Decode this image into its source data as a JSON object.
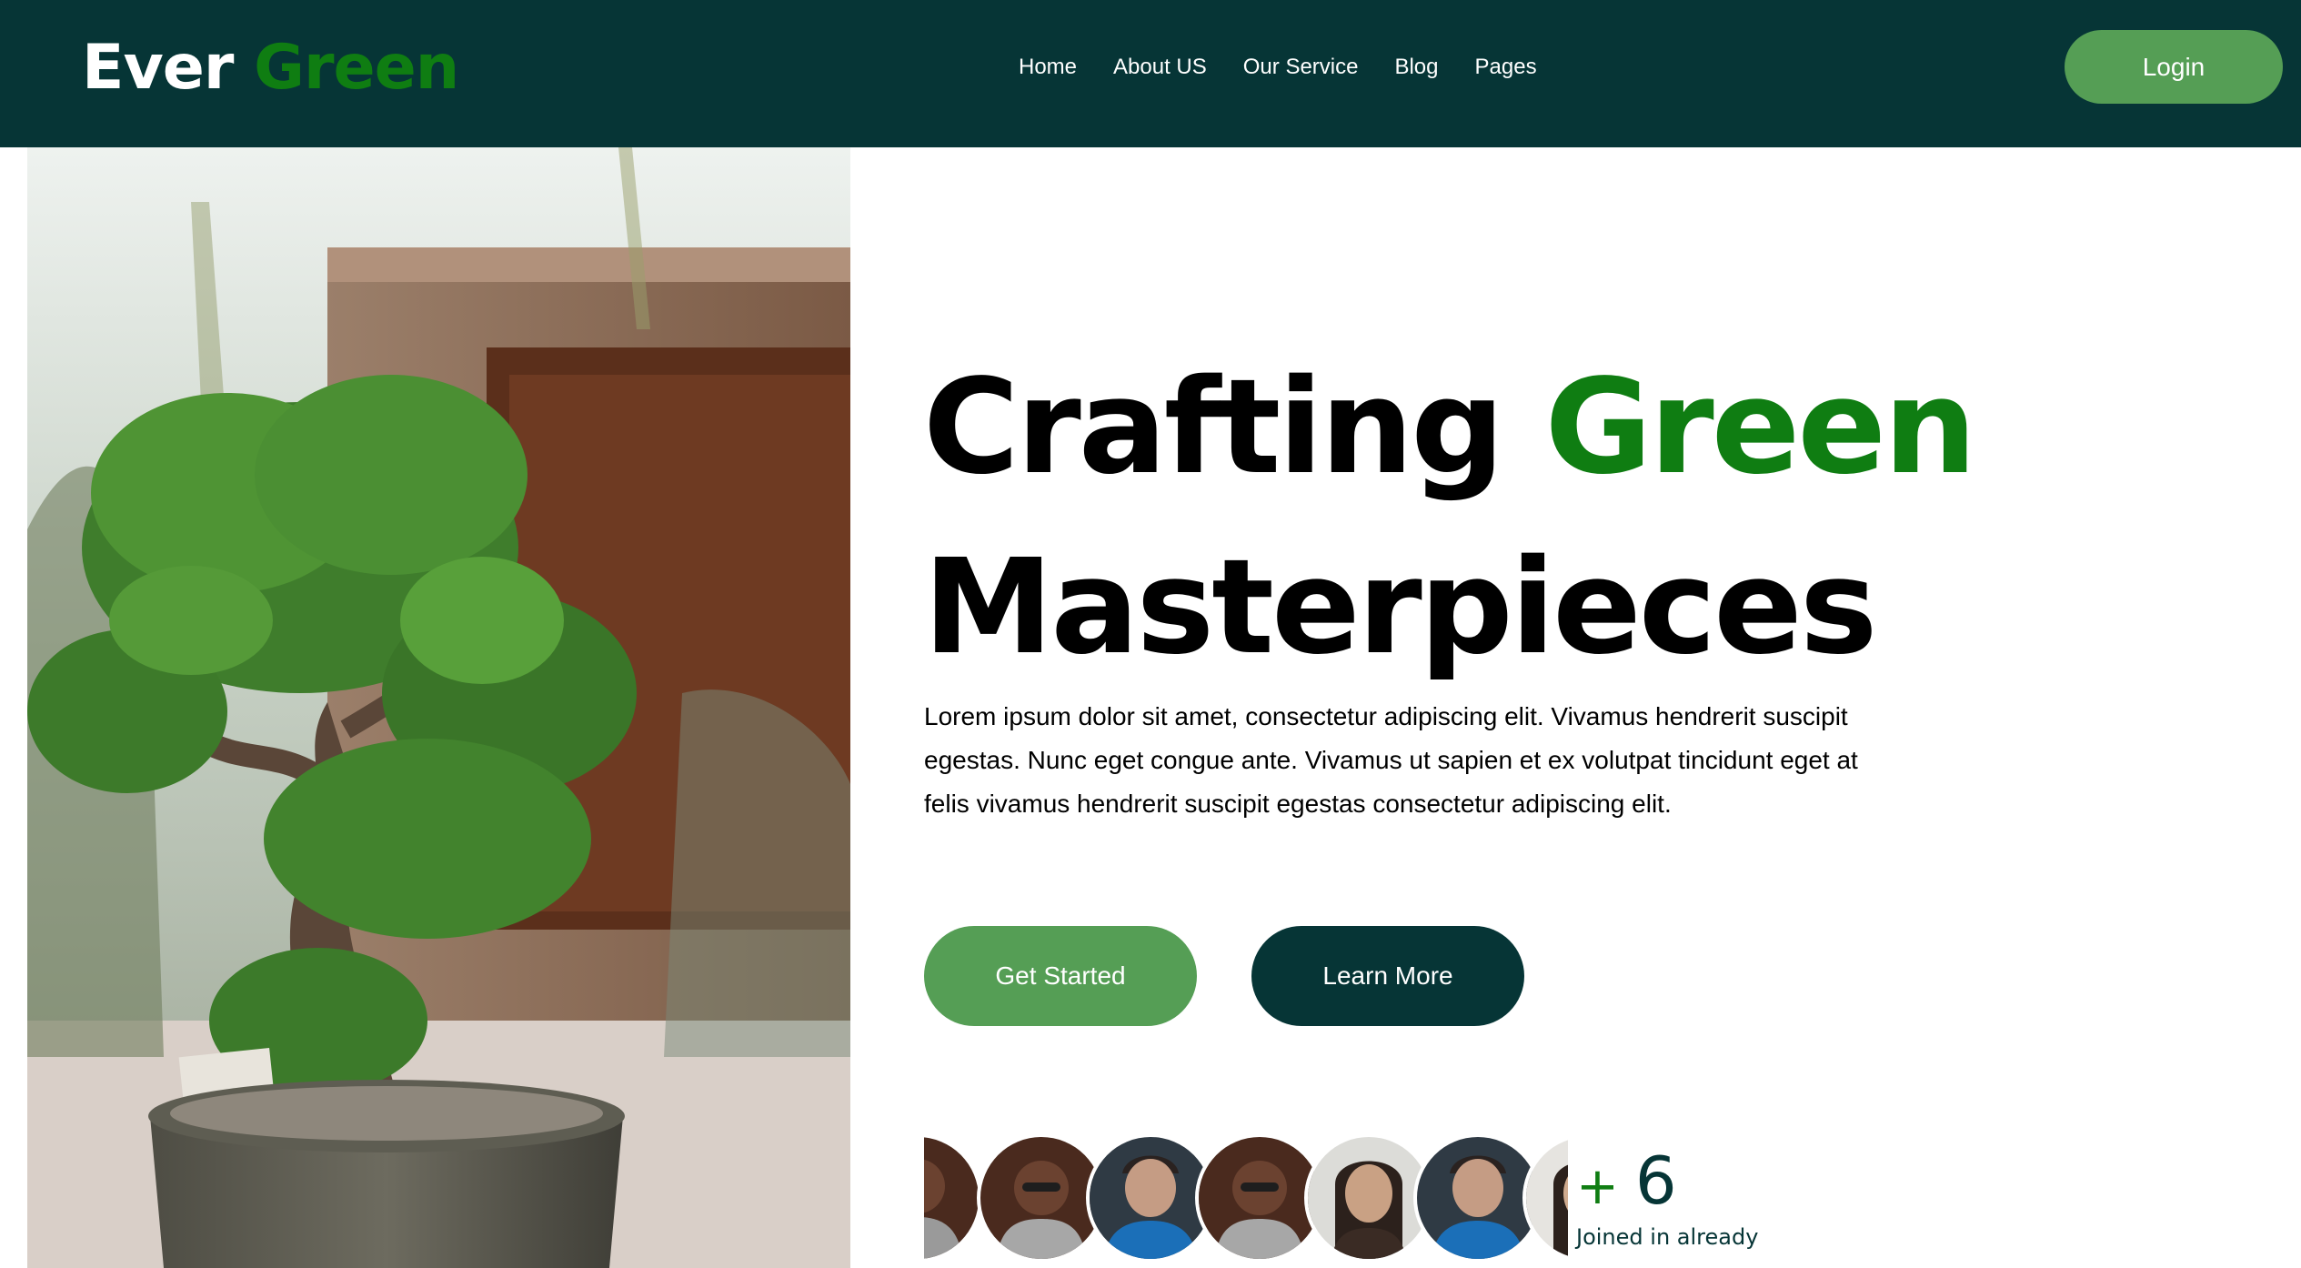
{
  "brand": {
    "name_primary": "Ever",
    "name_accent": "Green"
  },
  "nav": {
    "items": [
      "Home",
      "About US",
      "Our Service",
      "Blog",
      "Pages"
    ],
    "login_label": "Login"
  },
  "hero": {
    "headline_line1_primary": "Crafting",
    "headline_line1_accent": "Green",
    "headline_line2": "Masterpieces",
    "description": "Lorem ipsum dolor sit amet, consectetur adipiscing elit. Vivamus hendrerit suscipit egestas. Nunc eget congue ante. Vivamus ut sapien et ex volutpat tincidunt eget at felis vivamus hendrerit suscipit egestas consectetur adipiscing elit.",
    "primary_button": "Get Started",
    "secondary_button": "Learn More",
    "image": "bonsai-plant-photo"
  },
  "community": {
    "plus_sign": "+",
    "count": "6",
    "label": "Joined in already",
    "avatars": [
      "avatar-1",
      "avatar-2",
      "avatar-3",
      "avatar-4",
      "avatar-5",
      "avatar-6",
      "avatar-7"
    ]
  },
  "colors": {
    "nav_bg": "#063536",
    "accent_green": "#0f7d12",
    "button_green": "#559e55",
    "dark_teal": "#063536"
  }
}
